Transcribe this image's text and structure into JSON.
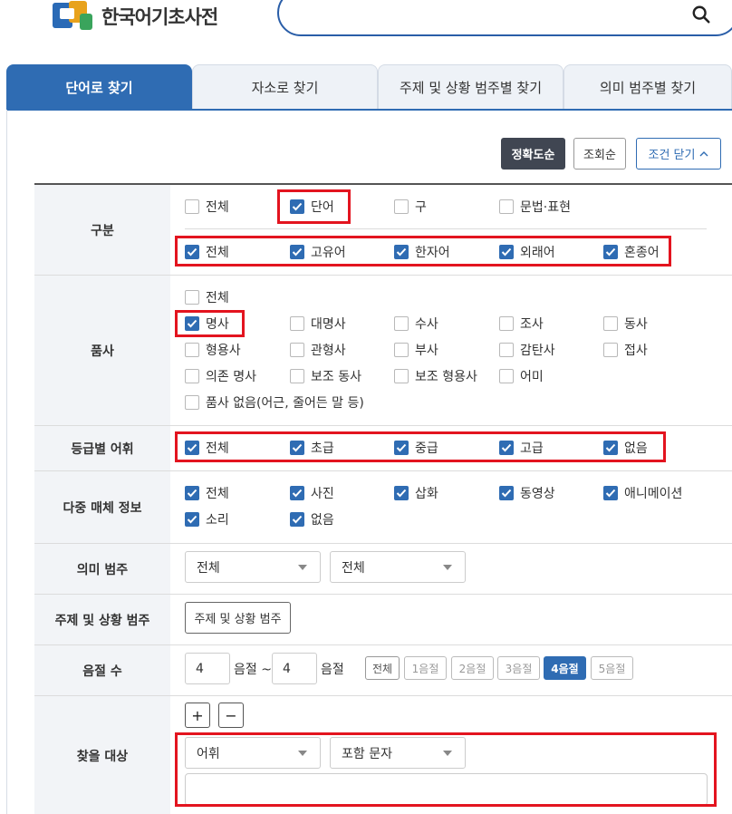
{
  "header": {
    "logo_text": "한국어기초사전",
    "search": {
      "value": "",
      "placeholder": ""
    }
  },
  "tabs": [
    {
      "label": "단어로 찾기",
      "active": true
    },
    {
      "label": "자소로 찾기",
      "active": false
    },
    {
      "label": "주제 및 상황 범주별 찾기",
      "active": false
    },
    {
      "label": "의미 범주별 찾기",
      "active": false
    }
  ],
  "sort": {
    "accuracy": "정확도순",
    "views": "조회순",
    "close_conditions": "조건 닫기"
  },
  "filters": {
    "category": {
      "label": "구분",
      "type_options": [
        {
          "label": "전체",
          "checked": false
        },
        {
          "label": "단어",
          "checked": true
        },
        {
          "label": "구",
          "checked": false
        },
        {
          "label": "문법·표현",
          "checked": false
        }
      ],
      "origin_options": [
        {
          "label": "전체",
          "checked": true
        },
        {
          "label": "고유어",
          "checked": true
        },
        {
          "label": "한자어",
          "checked": true
        },
        {
          "label": "외래어",
          "checked": true
        },
        {
          "label": "혼종어",
          "checked": true
        }
      ]
    },
    "pos": {
      "label": "품사",
      "options": [
        {
          "label": "전체",
          "checked": false
        },
        {
          "label": "명사",
          "checked": true
        },
        {
          "label": "대명사",
          "checked": false
        },
        {
          "label": "수사",
          "checked": false
        },
        {
          "label": "조사",
          "checked": false
        },
        {
          "label": "동사",
          "checked": false
        },
        {
          "label": "형용사",
          "checked": false
        },
        {
          "label": "관형사",
          "checked": false
        },
        {
          "label": "부사",
          "checked": false
        },
        {
          "label": "감탄사",
          "checked": false
        },
        {
          "label": "접사",
          "checked": false
        },
        {
          "label": "의존 명사",
          "checked": false
        },
        {
          "label": "보조 동사",
          "checked": false
        },
        {
          "label": "보조 형용사",
          "checked": false
        },
        {
          "label": "어미",
          "checked": false
        },
        {
          "label": "품사 없음(어근, 줄어든 말 등)",
          "checked": false
        }
      ]
    },
    "grade": {
      "label": "등급별 어휘",
      "options": [
        {
          "label": "전체",
          "checked": true
        },
        {
          "label": "초급",
          "checked": true
        },
        {
          "label": "중급",
          "checked": true
        },
        {
          "label": "고급",
          "checked": true
        },
        {
          "label": "없음",
          "checked": true
        }
      ]
    },
    "media": {
      "label": "다중 매체 정보",
      "options": [
        {
          "label": "전체",
          "checked": true
        },
        {
          "label": "사진",
          "checked": true
        },
        {
          "label": "삽화",
          "checked": true
        },
        {
          "label": "동영상",
          "checked": true
        },
        {
          "label": "애니메이션",
          "checked": true
        },
        {
          "label": "소리",
          "checked": true
        },
        {
          "label": "없음",
          "checked": true
        }
      ]
    },
    "meaning": {
      "label": "의미 범주",
      "select1": "전체",
      "select2": "전체"
    },
    "topic": {
      "label": "주제 및 상황 범주",
      "button": "주제 및 상황 범주"
    },
    "syllables": {
      "label": "음절 수",
      "from": "4",
      "from_unit": "음절 ~",
      "to": "4",
      "to_unit": "음절",
      "chips": [
        "전체",
        "1음절",
        "2음절",
        "3음절",
        "4음절",
        "5음절"
      ],
      "selected_chip": "4음절"
    },
    "target": {
      "label": "찾을 대상",
      "plus": "+",
      "minus": "−",
      "field_select": "어휘",
      "match_select": "포함 문자",
      "query": ""
    }
  },
  "colors": {
    "primary": "#2f6cb3",
    "dark_button": "#404652",
    "highlight": "#e3141f",
    "label_bg": "#f2f4f7"
  }
}
